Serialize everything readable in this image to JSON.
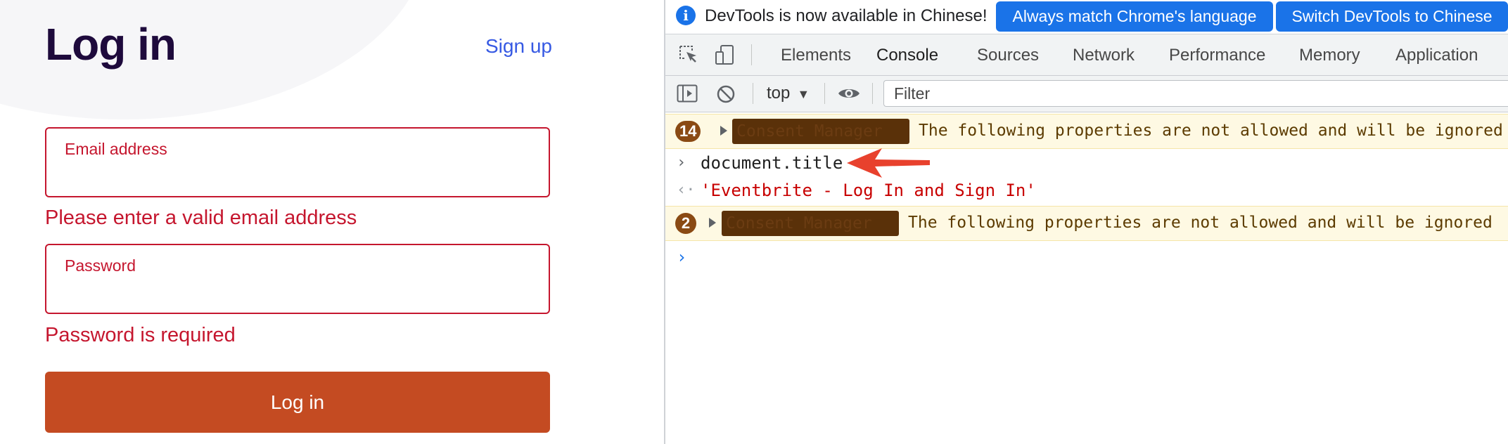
{
  "login": {
    "title": "Log in",
    "signup_link": "Sign up",
    "email": {
      "label": "Email address",
      "value": "",
      "error": "Please enter a valid email address"
    },
    "password": {
      "label": "Password",
      "value": "",
      "error": "Password is required"
    },
    "submit_label": "Log in"
  },
  "devtools": {
    "infobar": {
      "icon": "info-icon",
      "message": "DevTools is now available in Chinese!",
      "match_button": "Always match Chrome's language",
      "switch_button": "Switch DevTools to Chinese"
    },
    "tabs": [
      {
        "label": "Elements",
        "active": false
      },
      {
        "label": "Console",
        "active": true
      },
      {
        "label": "Sources",
        "active": false
      },
      {
        "label": "Network",
        "active": false
      },
      {
        "label": "Performance",
        "active": false
      },
      {
        "label": "Memory",
        "active": false
      },
      {
        "label": "Application",
        "active": false
      }
    ],
    "toolbar": {
      "context": "top",
      "filter_placeholder": "Filter"
    },
    "console": {
      "messages": [
        {
          "type": "warning",
          "count": "14",
          "tag": "Consent Manager",
          "text": "The following properties are not allowed and will be ignored"
        },
        {
          "type": "input",
          "text": "document.title"
        },
        {
          "type": "output",
          "text": "'Eventbrite - Log In and Sign In'"
        },
        {
          "type": "warning",
          "count": "2",
          "tag": "Consent Manager",
          "text": "The following properties are not allowed and will be ignored"
        }
      ]
    },
    "colors": {
      "accent": "#1a73e8",
      "error": "#c5162e",
      "login_button": "#c44b22",
      "warning_badge": "#8a4a13",
      "annotation_arrow": "#e8412d"
    }
  }
}
